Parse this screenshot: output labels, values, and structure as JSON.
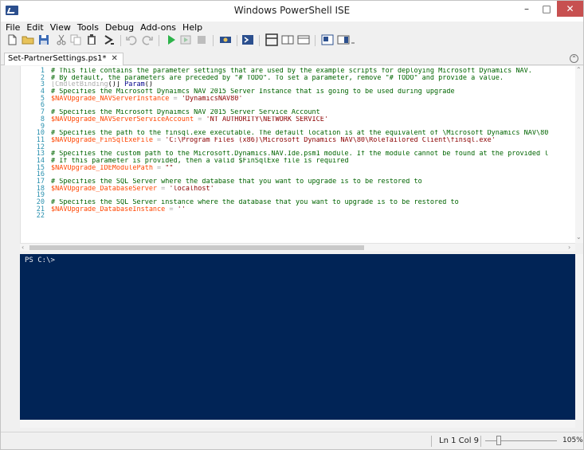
{
  "window": {
    "title": "Windows PowerShell ISE",
    "min_label": "–",
    "max_label": "□",
    "close_label": "✕"
  },
  "menu": [
    "File",
    "Edit",
    "View",
    "Tools",
    "Debug",
    "Add-ons",
    "Help"
  ],
  "toolbar": {
    "items": [
      "new-script",
      "open",
      "save",
      "cut",
      "copy",
      "paste",
      "clear-console",
      "undo",
      "redo",
      "run-script",
      "run-selection",
      "stop",
      "new-remote-tab",
      "start-powershell",
      "show-script-pane-top",
      "show-script-pane-right",
      "show-script-pane-maximized",
      "show-command-window",
      "show-command-addon"
    ]
  },
  "tab": {
    "label": "Set-PartnerSettings.ps1*",
    "close_label": "✕"
  },
  "script": {
    "line_numbers": [
      "1",
      "2",
      "3",
      "4",
      "5",
      "6",
      "7",
      "8",
      "9",
      "10",
      "11",
      "12",
      "13",
      "14",
      "15",
      "16",
      "17",
      "18",
      "19",
      "20",
      "21",
      "22"
    ],
    "lines": [
      [
        {
          "t": "c-comment",
          "v": "# This file contains the parameter settings that are used by the example scripts for deploying Microsoft Dynamics NAV."
        }
      ],
      [
        {
          "t": "c-comment",
          "v": "# By default, the parameters are preceded by \"# TODO\". To set a parameter, remove \"# TODO\" and provide a value."
        }
      ],
      [
        {
          "t": "c-attr",
          "v": "[CmdletBinding"
        },
        {
          "t": "c-plain",
          "v": "()] "
        },
        {
          "t": "c-kw",
          "v": "Param"
        },
        {
          "t": "c-plain",
          "v": "()"
        }
      ],
      [
        {
          "t": "c-comment",
          "v": "# Specifies the Microsoft Dynaimcs NAV 2015 Server Instance that is going to be used during upgrade"
        }
      ],
      [
        {
          "t": "c-var",
          "v": "$NAVUpgrade_NAVServerInstance"
        },
        {
          "t": "c-op",
          "v": " = "
        },
        {
          "t": "c-str",
          "v": "'DynamicsNAV80'"
        }
      ],
      [
        {
          "t": "c-plain",
          "v": ""
        }
      ],
      [
        {
          "t": "c-comment",
          "v": "# Specifies the Microsoft Dynaimcs NAV 2015 Server Service Account"
        }
      ],
      [
        {
          "t": "c-var",
          "v": "$NAVUpgrade_NAVServerServiceAccount"
        },
        {
          "t": "c-op",
          "v": " = "
        },
        {
          "t": "c-str",
          "v": "'NT AUTHORITY\\NETWORK SERVICE'"
        }
      ],
      [
        {
          "t": "c-plain",
          "v": ""
        }
      ],
      [
        {
          "t": "c-comment",
          "v": "# Specifies the path to the finsql.exe executable. The default location is at the equivalent of \\Microsoft Dynamics NAV\\80"
        }
      ],
      [
        {
          "t": "c-var",
          "v": "$NAVUpgrade_FinSqlExeFile"
        },
        {
          "t": "c-op",
          "v": " = "
        },
        {
          "t": "c-str",
          "v": "'C:\\Program Files (x86)\\Microsoft Dynamics NAV\\80\\RoleTailored Client\\finsql.exe'"
        }
      ],
      [
        {
          "t": "c-plain",
          "v": ""
        }
      ],
      [
        {
          "t": "c-comment",
          "v": "# Specifies the custom path to the Microsoft.Dynamics.NAV.Ide.psm1 module. If the module cannot be found at the provided l"
        }
      ],
      [
        {
          "t": "c-comment",
          "v": "# If this parameter is provided, then a valid $FinSqlExe file is required"
        }
      ],
      [
        {
          "t": "c-var",
          "v": "$NAVUpgrade_IDEModulePath"
        },
        {
          "t": "c-op",
          "v": " = "
        },
        {
          "t": "c-str",
          "v": "\"\""
        }
      ],
      [
        {
          "t": "c-plain",
          "v": ""
        }
      ],
      [
        {
          "t": "c-comment",
          "v": "# Specifies the SQL Server where the database that you want to upgrade is to be restored to"
        }
      ],
      [
        {
          "t": "c-var",
          "v": "$NAVUpgrade_DatabaseServer"
        },
        {
          "t": "c-op",
          "v": " = "
        },
        {
          "t": "c-str",
          "v": "'localhost'"
        }
      ],
      [
        {
          "t": "c-plain",
          "v": ""
        }
      ],
      [
        {
          "t": "c-comment",
          "v": "# Specifies the SQL Server instance where the database that you want to upgrade is to be restored to"
        }
      ],
      [
        {
          "t": "c-var",
          "v": "$NAVUpgrade_DatabaseInstance"
        },
        {
          "t": "c-op",
          "v": " = "
        },
        {
          "t": "c-str",
          "v": "''"
        }
      ],
      [
        {
          "t": "c-plain",
          "v": ""
        }
      ]
    ]
  },
  "console": {
    "prompt": "PS C:\\>"
  },
  "status": {
    "position": "Ln 1  Col 9",
    "zoom": "105%"
  },
  "colors": {
    "console_bg": "#012456",
    "comment": "#006400",
    "variable": "#ff4500",
    "string": "#8b0000",
    "close_button": "#c75050"
  }
}
